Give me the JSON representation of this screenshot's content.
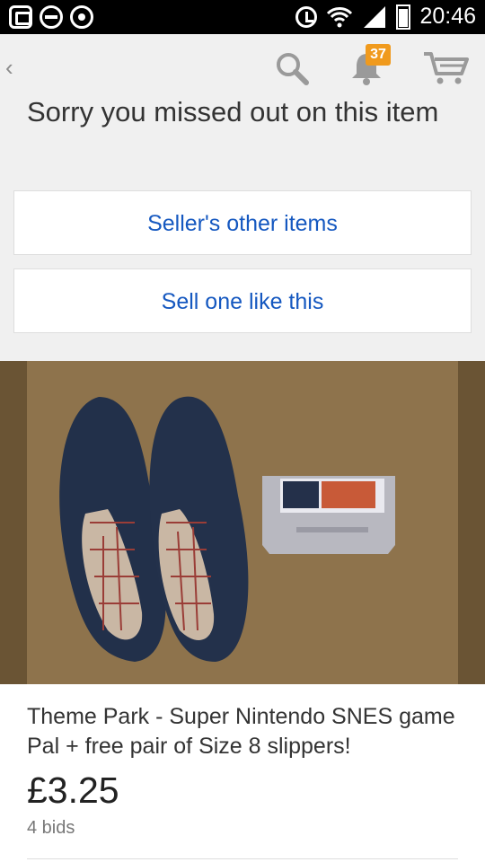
{
  "status_bar": {
    "time": "20:46",
    "icons": [
      "chat-head-icon",
      "minus-circle-icon",
      "disc-icon",
      "alarm-icon",
      "wifi-icon",
      "signal-icon",
      "battery-icon"
    ]
  },
  "app_bar": {
    "back_glyph": "‹",
    "notification_count": "37",
    "icons": [
      "back-icon",
      "search-icon",
      "bell-icon",
      "cart-icon"
    ]
  },
  "missed": {
    "title": "Sorry you missed out on this item"
  },
  "actions": {
    "sellers_other_items": "Seller's other items",
    "sell_one_like_this": "Sell one like this"
  },
  "listing": {
    "title": "Theme Park - Super Nintendo SNES game Pal + free pair of Size 8 slippers!",
    "price": "£3.25",
    "bids": "4 bids"
  },
  "colors": {
    "link": "#1558c0",
    "badge": "#f09a1d",
    "background": "#f0f0f0"
  }
}
